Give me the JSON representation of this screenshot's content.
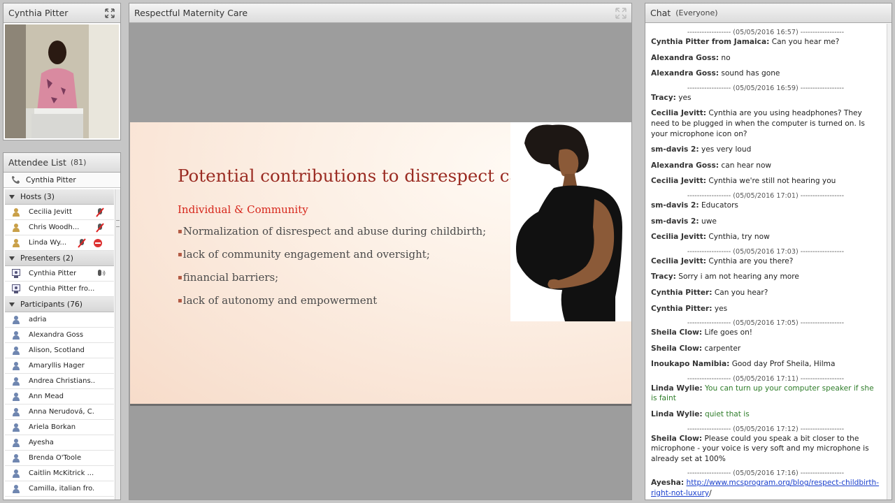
{
  "camera": {
    "title": "Cynthia Pitter"
  },
  "attendees": {
    "title": "Attendee List",
    "count": "(81)",
    "me": "Cynthia Pitter",
    "hosts_label": "Hosts (3)",
    "hosts": [
      "Cecilia Jevitt",
      "Chris Woodh...",
      "Linda Wy..."
    ],
    "presenters_label": "Presenters (2)",
    "presenters": [
      "Cynthia Pitter",
      "Cynthia Pitter fro..."
    ],
    "participants_label": "Participants (76)",
    "participants": [
      "adria",
      "Alexandra Goss",
      "Alison, Scotland",
      "Amaryllis Hager",
      "Andrea Christians...",
      "Ann Mead",
      "Anna Nerudová, C...",
      "Ariela Borkan",
      "Ayesha",
      "Brenda O'Toole",
      "Caitlin McKitrick ...",
      "Camilla, italian fro..."
    ]
  },
  "share": {
    "title": "Respectful Maternity Care",
    "slide": {
      "title": "Potential contributions to disrespect care",
      "subtitle": "Individual & Community",
      "bullets": [
        "Normalization of disrespect and abuse during childbirth;",
        "lack of community engagement and oversight;",
        "financial barriers;",
        "lack of autonomy and empowerment"
      ]
    }
  },
  "chat": {
    "title": "Chat",
    "scope": "(Everyone)",
    "entries": [
      {
        "kind": "ts",
        "text": "------------------ (05/05/2016 16:57) ------------------"
      },
      {
        "kind": "msg",
        "who": "Cynthia Pitter from Jamaica:",
        "text": " Can you hear me?"
      },
      {
        "kind": "msg",
        "who": "Alexandra Goss:",
        "text": " no"
      },
      {
        "kind": "msg",
        "who": "Alexandra Goss:",
        "text": " sound has gone"
      },
      {
        "kind": "ts",
        "text": "------------------ (05/05/2016 16:59) ------------------"
      },
      {
        "kind": "msg",
        "who": "Tracy:",
        "text": " yes"
      },
      {
        "kind": "msg",
        "who": "Cecilia Jevitt:",
        "text": " Cynthia are you using headphones? They need to be plugged in when the computer is turned on. Is your microphone icon on?"
      },
      {
        "kind": "msg",
        "who": "sm-davis 2:",
        "text": " yes very loud"
      },
      {
        "kind": "msg",
        "who": "Alexandra Goss:",
        "text": " can hear now"
      },
      {
        "kind": "msg",
        "who": "Cecilia Jevitt:",
        "text": " Cynthia we're still not hearing you"
      },
      {
        "kind": "ts",
        "text": "------------------ (05/05/2016 17:01) ------------------"
      },
      {
        "kind": "msg",
        "who": "sm-davis 2:",
        "text": " Educators"
      },
      {
        "kind": "msg",
        "who": "sm-davis 2:",
        "text": " uwe"
      },
      {
        "kind": "msg",
        "who": "Cecilia Jevitt:",
        "text": " Cynthia, try now"
      },
      {
        "kind": "ts",
        "text": "------------------ (05/05/2016 17:03) ------------------"
      },
      {
        "kind": "msg",
        "who": "Cecilia Jevitt:",
        "text": " Cynthia are you there?"
      },
      {
        "kind": "msg",
        "who": "Tracy:",
        "text": " Sorry i am not hearing any more"
      },
      {
        "kind": "msg",
        "who": "Cynthia Pitter:",
        "text": " Can you hear?"
      },
      {
        "kind": "msg",
        "who": "Cynthia Pitter:",
        "text": " yes"
      },
      {
        "kind": "ts",
        "text": "------------------ (05/05/2016 17:05) ------------------"
      },
      {
        "kind": "msg",
        "who": "Sheila Clow:",
        "text": " Life goes on!"
      },
      {
        "kind": "msg",
        "who": "Sheila Clow:",
        "text": " carpenter"
      },
      {
        "kind": "msg",
        "who": "Inoukapo Namibia:",
        "text": " Good day Prof Sheila,  Hilma"
      },
      {
        "kind": "ts",
        "text": "------------------ (05/05/2016 17:11) ------------------"
      },
      {
        "kind": "msg",
        "color": "green",
        "who": "Linda Wylie:",
        "text": " You can turn up your computer speaker if she is faint"
      },
      {
        "kind": "msg",
        "color": "green",
        "who": "Linda Wylie:",
        "text": " quiet that is"
      },
      {
        "kind": "ts",
        "text": "------------------ (05/05/2016 17:12) ------------------"
      },
      {
        "kind": "msg",
        "who": "Sheila Clow:",
        "text": " Please could you speak a bit closer to the microphone - your voice is very soft and my microphone is already set at 100%"
      },
      {
        "kind": "ts",
        "text": "------------------ (05/05/2016 17:16) ------------------"
      },
      {
        "kind": "link",
        "who": "Ayesha:",
        "link": "http://www.mcsprogram.org/blog/respect-childbirth-right-not-luxury",
        "after": "/"
      }
    ]
  },
  "colors": {
    "slide_title": "#9a2b22",
    "slide_sub": "#d6261b",
    "chat_green": "#2f7d2a",
    "link": "#1a3fcc"
  }
}
